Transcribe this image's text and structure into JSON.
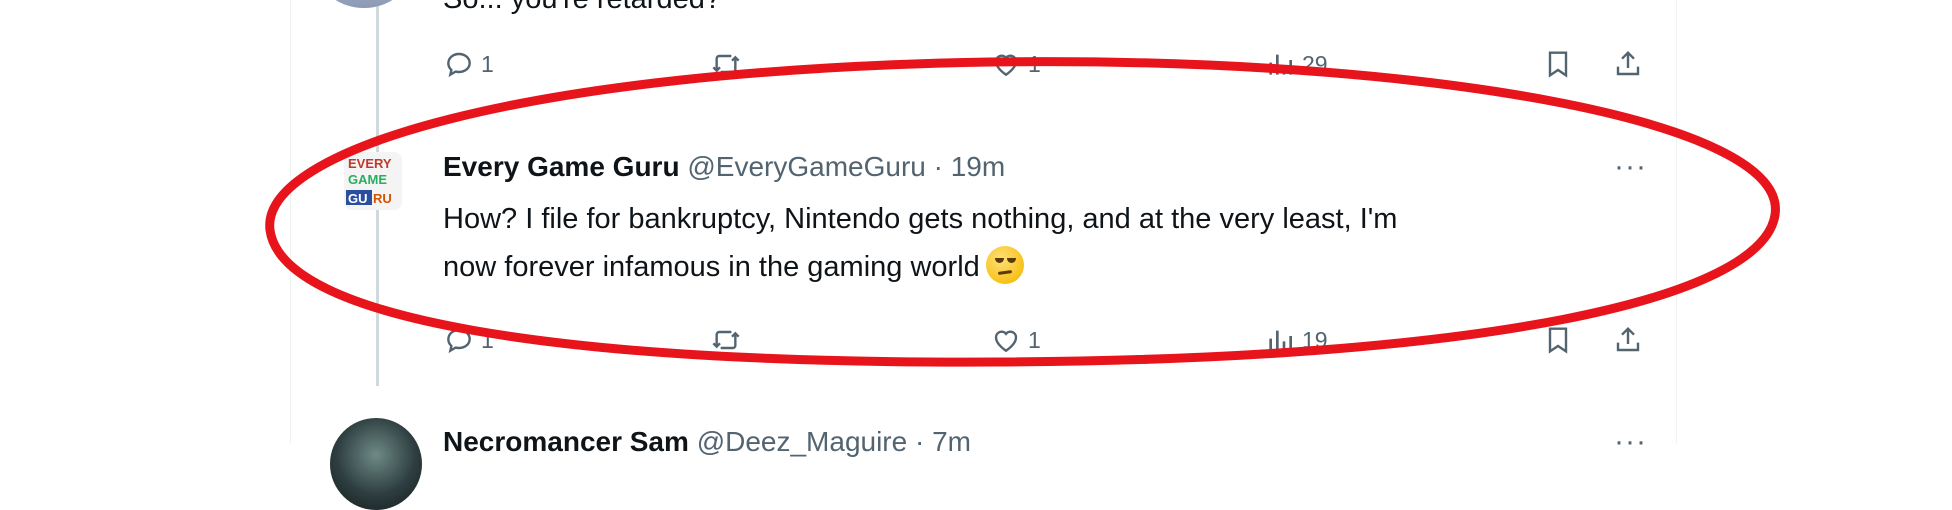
{
  "prev_tweet": {
    "text_partial": "So... you're retarded?",
    "actions": {
      "replies": "1",
      "retweets": "",
      "likes": "1",
      "views": "29"
    }
  },
  "main_tweet": {
    "name": "Every Game Guru",
    "handle": "@EveryGameGuru",
    "separator": "·",
    "time": "19m",
    "text_line1": "How? I file for bankruptcy, Nintendo gets nothing, and at the very least, I'm",
    "text_line2": "now forever infamous in the gaming world",
    "more": "···",
    "actions": {
      "replies": "1",
      "retweets": "",
      "likes": "1",
      "views": "19"
    },
    "avatar_text": "EVERY GAME GURU"
  },
  "next_tweet": {
    "name": "Necromancer Sam",
    "handle": "@Deez_Maguire",
    "separator": "·",
    "time": "7m",
    "more": "···"
  },
  "colors": {
    "annotation": "#e8141c",
    "muted": "#536471",
    "thread_line": "#cfd9de"
  },
  "icons": [
    "reply-icon",
    "retweet-icon",
    "like-icon",
    "views-icon",
    "bookmark-icon",
    "share-icon",
    "more-icon"
  ]
}
